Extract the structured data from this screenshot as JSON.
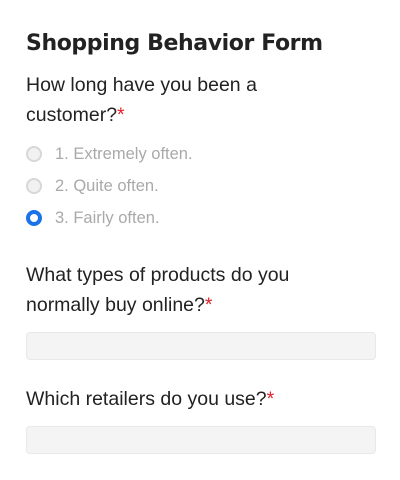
{
  "form": {
    "title": "Shopping Behavior Form",
    "required_marker": "*",
    "questions": [
      {
        "label": "How long have you been a customer?",
        "type": "radio",
        "options": [
          {
            "label": "1. Extremely often.",
            "selected": false
          },
          {
            "label": "2. Quite often.",
            "selected": false
          },
          {
            "label": "3. Fairly often.",
            "selected": true
          }
        ]
      },
      {
        "label": "What types of products do you normally buy online?",
        "type": "text",
        "value": "",
        "placeholder": ""
      },
      {
        "label": "Which retailers do you use?",
        "type": "text",
        "value": "",
        "placeholder": ""
      }
    ]
  },
  "colors": {
    "accent": "#1a73e8",
    "required": "#e3212c",
    "option_text": "#a9a9a9",
    "input_background": "#f4f4f4"
  }
}
